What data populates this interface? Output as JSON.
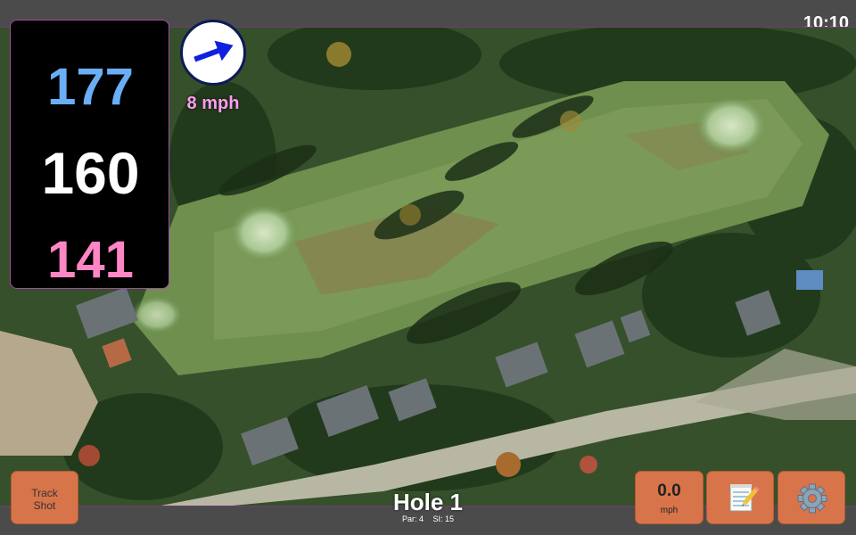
{
  "status": {
    "time": "10:10"
  },
  "distances": {
    "back": "177",
    "middle": "160",
    "front": "141"
  },
  "wind": {
    "speed_label": "8 mph",
    "direction": "east-northeast"
  },
  "hole": {
    "title": "Hole 1",
    "par_label": "Par: 4",
    "si_label": "SI: 15"
  },
  "buttons": {
    "track_line1": "Track",
    "track_line2": "Shot",
    "speed_value": "0.0",
    "speed_unit": "mph",
    "notes_icon": "notepad-icon",
    "settings_icon": "gear-icon"
  },
  "colors": {
    "back_distance": "#6aaef5",
    "middle_distance": "#ffffff",
    "front_distance": "#ff86c4",
    "wind_label": "#ff9cf2",
    "button": "#d8744a",
    "wind_arrow": "#1020e0"
  }
}
